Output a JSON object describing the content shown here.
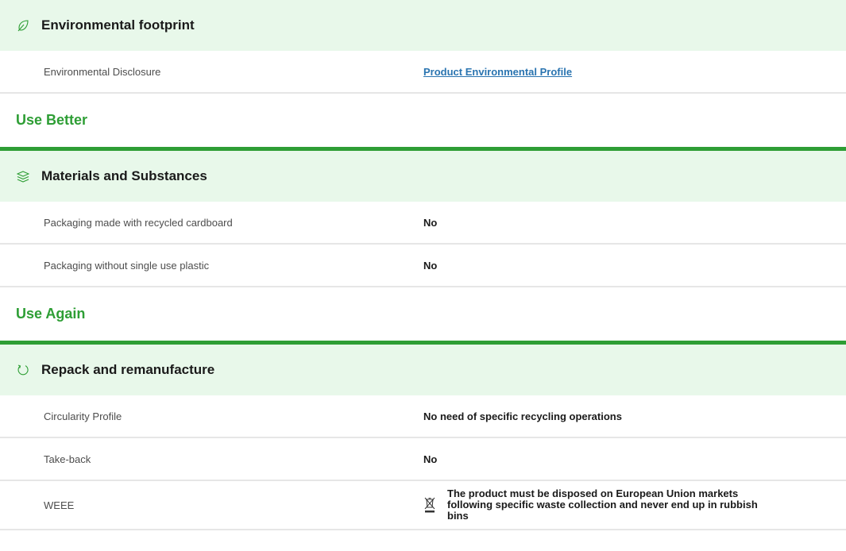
{
  "sections": {
    "environmental": {
      "icon": "leaf-icon",
      "title": "Environmental footprint",
      "rows": [
        {
          "label": "Environmental Disclosure",
          "value": "Product Environmental Profile"
        }
      ]
    },
    "use_better": {
      "heading": "Use Better",
      "card_icon": "layers-icon",
      "card_title": "Materials and Substances",
      "rows": [
        {
          "label": "Packaging made with recycled cardboard",
          "value": "No"
        },
        {
          "label": "Packaging without single use plastic",
          "value": "No"
        }
      ]
    },
    "use_again": {
      "heading": "Use Again",
      "card_icon": "refresh-icon",
      "card_title": "Repack and remanufacture",
      "rows": [
        {
          "label": "Circularity Profile",
          "value": "No need of specific recycling operations"
        },
        {
          "label": "Take-back",
          "value": "No"
        },
        {
          "label": "WEEE",
          "value": "The product must be disposed on European Union markets following specific waste collection and never end up in rubbish bins"
        }
      ]
    }
  },
  "colors": {
    "accent_green": "#2e9e35",
    "header_bg": "#e8f8ea",
    "link_blue": "#2a74b0"
  }
}
